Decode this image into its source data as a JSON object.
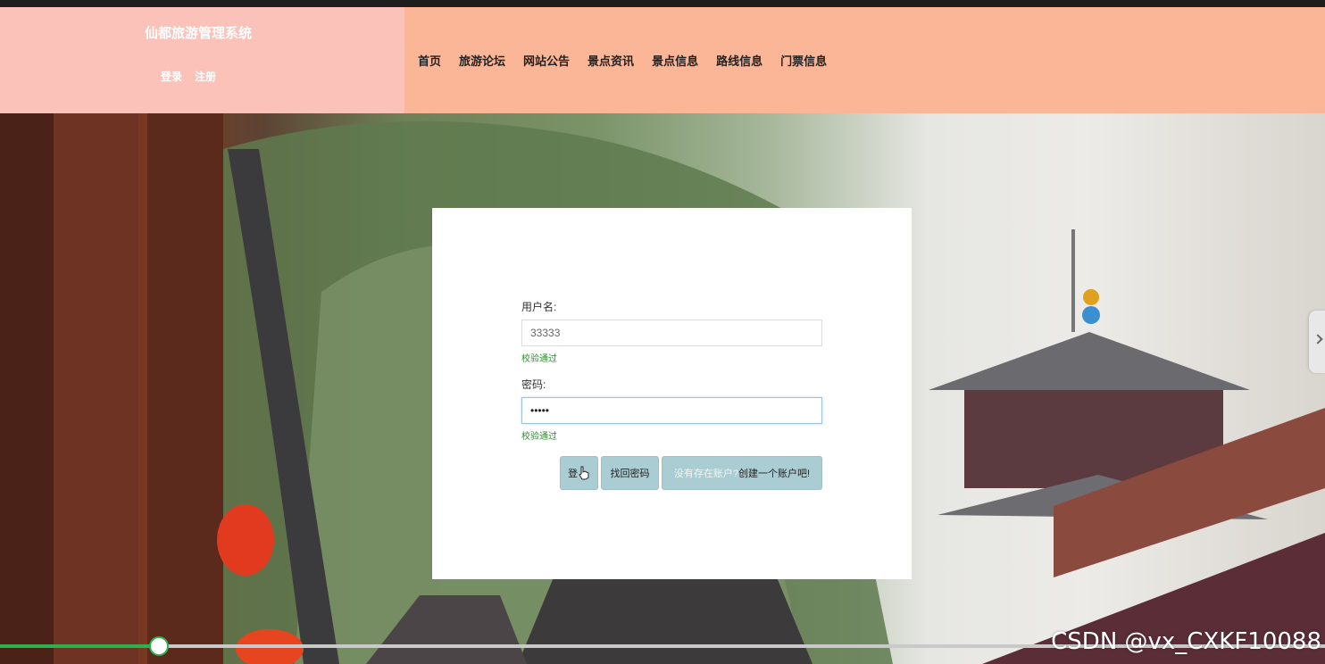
{
  "site": {
    "title": "仙都旅游管理系统",
    "login_link": "登录",
    "register_link": "注册"
  },
  "nav": [
    {
      "label": "首页"
    },
    {
      "label": "旅游论坛"
    },
    {
      "label": "网站公告"
    },
    {
      "label": "景点资讯"
    },
    {
      "label": "景点信息"
    },
    {
      "label": "路线信息"
    },
    {
      "label": "门票信息"
    }
  ],
  "login_form": {
    "username_label": "用户名:",
    "username_value": "33333",
    "username_status": "校验通过",
    "password_label": "密码:",
    "password_value": "•••••",
    "password_status": "校验通过",
    "login_button": "登",
    "find_password_button": "找回密码",
    "register_prompt_muted": "没有存在账户?",
    "register_prompt": "创建一个账户吧!"
  },
  "video": {
    "progress": 0.12
  },
  "watermark": "CSDN @vx_CXKF10088",
  "icons": {
    "carousel_next": "chevron-right-icon",
    "cursor": "hand-pointer-icon"
  },
  "colors": {
    "brand_bg": "#fac2b8",
    "nav_bg": "#fbb597",
    "button_bg": "#a9cdd2",
    "valid_text": "#2f8a2f",
    "progress": "#2db14f"
  }
}
